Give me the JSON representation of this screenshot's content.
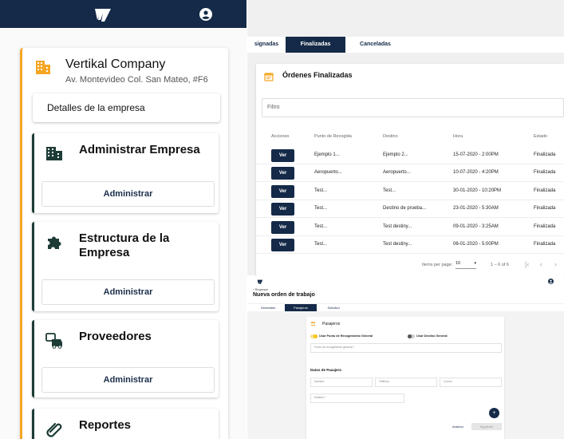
{
  "colors": {
    "navy": "#152a48",
    "accent_orange": "#f5a623",
    "module_border": "#1d3c36",
    "toggle_yellow": "#f5c518"
  },
  "left": {
    "company": {
      "name": "Vertikal Company",
      "address": "Av. Montevideo Col. San Mateo, #F6",
      "icon": "building-icon"
    },
    "details_button": "Detalles de la empresa",
    "modules": [
      {
        "title": "Administrar Empresa",
        "icon": "building-icon",
        "button": "Administrar"
      },
      {
        "title": "Estructura de la Empresa",
        "icon": "puzzle-icon",
        "button": "Administrar"
      },
      {
        "title": "Proveedores",
        "icon": "vehicles-icon",
        "button": "Administrar"
      },
      {
        "title": "Reportes",
        "icon": "paperclip-icon"
      }
    ]
  },
  "orders": {
    "tabs": [
      "signadas",
      "Finalizadas",
      "Canceladas"
    ],
    "active_tab": "Finalizadas",
    "title": "Órdenes Finalizadas",
    "filter_placeholder": "Filtro",
    "columns": [
      "Acciones",
      "Punto de Recogida",
      "Destino",
      "Hora",
      "Estado"
    ],
    "rows": [
      {
        "action": "Ver",
        "pickup": "Ejemplo 1...",
        "destination": "Ejemplo 2...",
        "time": "15-07-2020 - 2:00PM",
        "status": "Finalizada"
      },
      {
        "action": "Ver",
        "pickup": "Aeropuerto...",
        "destination": "Aeropuerto...",
        "time": "10-07-2020 - 4:20PM",
        "status": "Finalizada"
      },
      {
        "action": "Ver",
        "pickup": "Test...",
        "destination": "Test...",
        "time": "30-01-2020 - 10:20PM",
        "status": "Finalizada"
      },
      {
        "action": "Ver",
        "pickup": "Test...",
        "destination": "Destino de prueba...",
        "time": "23-01-2020 - 5:30AM",
        "status": "Finalizada"
      },
      {
        "action": "Ver",
        "pickup": "Test...",
        "destination": "Test destiny...",
        "time": "09-01-2020 - 3:25AM",
        "status": "Finalizada"
      },
      {
        "action": "Ver",
        "pickup": "Test...",
        "destination": "Test destiny...",
        "time": "06-01-2020 - 5:00PM",
        "status": "Finalizada"
      }
    ],
    "pager": {
      "items_label": "Items per page:",
      "per_page": "10",
      "range": "1 – 6 of 6"
    }
  },
  "new_order": {
    "back": "Regresar",
    "title": "Nueva orden de trabajo",
    "tabs": [
      "Generales",
      "Pasajeros",
      "Solicitud"
    ],
    "active_tab": "Pasajeros",
    "section_title": "Pasajeros",
    "toggle1": "Usar Punto de Recogimiento General",
    "toggle2": "Usar Destino General",
    "pickup_field": "Punto de recogimiento general *",
    "passenger_heading": "Datos de Pasajero",
    "name_field": "Nombre",
    "phone_field": "Teléfono",
    "email_field": "Correo",
    "destination_field": "Destino *",
    "btn_prev": "Anterior",
    "btn_next": "Siguiente"
  }
}
